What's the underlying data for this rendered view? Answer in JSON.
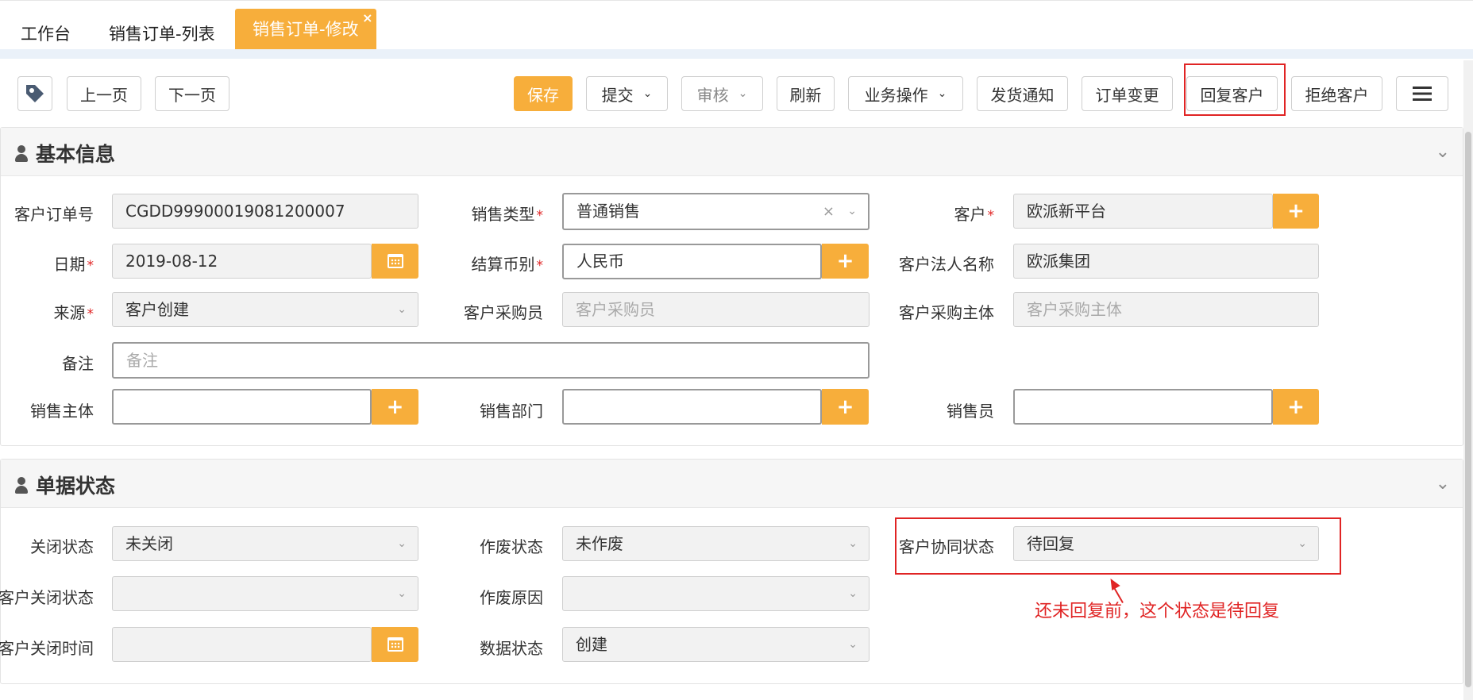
{
  "tabs": [
    {
      "label": "工作台"
    },
    {
      "label": "销售订单-列表"
    },
    {
      "label": "销售订单-修改",
      "active": true,
      "close": "×"
    }
  ],
  "toolbar": {
    "prev": "上一页",
    "next": "下一页",
    "save": "保存",
    "submit": "提交",
    "audit": "审核",
    "refresh": "刷新",
    "business": "业务操作",
    "ship_notice": "发货通知",
    "order_change": "订单变更",
    "reply_customer": "回复客户",
    "reject_customer": "拒绝客户"
  },
  "sections": {
    "basic": {
      "title": "基本信息",
      "fields": {
        "customer_order_no": {
          "label": "客户订单号",
          "value": "CGDD99900019081200007"
        },
        "sales_type": {
          "label": "销售类型",
          "value": "普通销售"
        },
        "customer": {
          "label": "客户",
          "value": "欧派新平台"
        },
        "date": {
          "label": "日期",
          "value": "2019-08-12"
        },
        "currency": {
          "label": "结算币别",
          "value": "人民币"
        },
        "legal_name": {
          "label": "客户法人名称",
          "value": "欧派集团"
        },
        "source": {
          "label": "来源",
          "value": "客户创建"
        },
        "buyer": {
          "label": "客户采购员",
          "placeholder": "客户采购员"
        },
        "purchase_entity": {
          "label": "客户采购主体",
          "placeholder": "客户采购主体"
        },
        "remark": {
          "label": "备注",
          "placeholder": "备注"
        },
        "sales_entity": {
          "label": "销售主体",
          "value": ""
        },
        "sales_dept": {
          "label": "销售部门",
          "value": ""
        },
        "salesman": {
          "label": "销售员",
          "value": ""
        }
      }
    },
    "status": {
      "title": "单据状态",
      "fields": {
        "close_status": {
          "label": "关闭状态",
          "value": "未关闭"
        },
        "void_status": {
          "label": "作废状态",
          "value": "未作废"
        },
        "collab_status": {
          "label": "客户协同状态",
          "value": "待回复"
        },
        "cust_close_status": {
          "label": "客户关闭状态",
          "value": ""
        },
        "void_reason": {
          "label": "作废原因",
          "value": ""
        },
        "cust_close_time": {
          "label": "客户关闭时间",
          "value": ""
        },
        "data_status": {
          "label": "数据状态",
          "value": "创建"
        }
      }
    }
  },
  "annotation": "还未回复前，这个状态是待回复",
  "colors": {
    "accent": "#f7ae3b",
    "highlight": "#e02424"
  }
}
